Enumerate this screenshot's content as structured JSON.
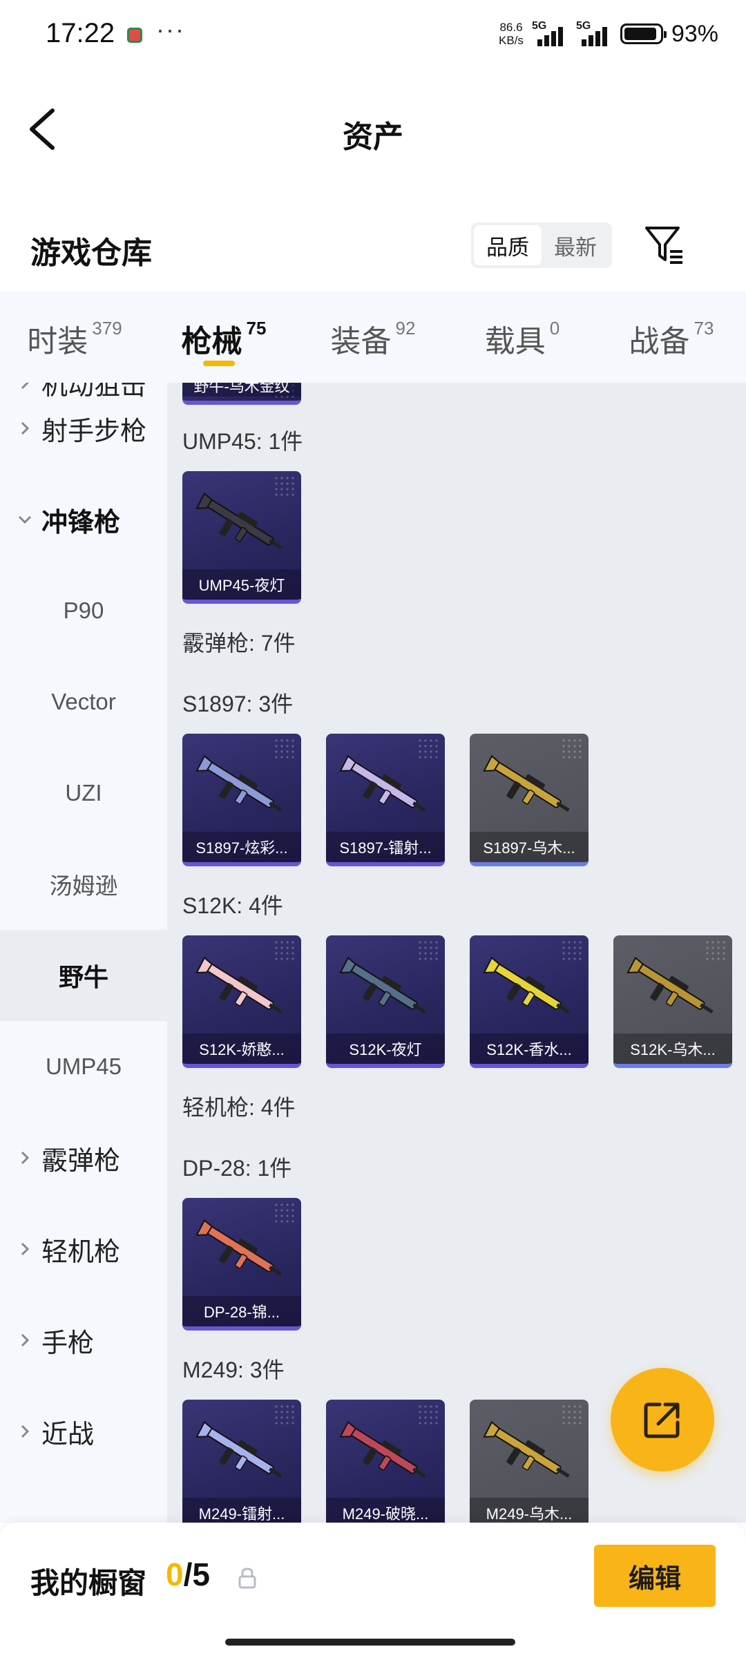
{
  "status_bar": {
    "time": "17:22",
    "more": "···",
    "net_speed_value": "86.6",
    "net_speed_unit": "KB/s",
    "signal1_label": "5G",
    "signal2_label": "5G",
    "battery_pct": "93%",
    "battery_level": 0.93
  },
  "header": {
    "title": "资产",
    "back_icon": "chevron-left-icon"
  },
  "warehouse": {
    "title": "游戏仓库",
    "sort_options": [
      "品质",
      "最新"
    ],
    "sort_selected": "品质",
    "filter_icon": "filter-icon"
  },
  "tabs": [
    {
      "label": "时装",
      "count": "379",
      "active": false
    },
    {
      "label": "枪械",
      "count": "75",
      "active": true
    },
    {
      "label": "装备",
      "count": "92",
      "active": false
    },
    {
      "label": "载具",
      "count": "0",
      "active": false
    },
    {
      "label": "战备",
      "count": "73",
      "active": false
    }
  ],
  "sidebar": {
    "items": [
      {
        "label": "射手步枪",
        "type": "group"
      },
      {
        "label": "冲锋枪",
        "type": "group",
        "open": true
      },
      {
        "label": "P90",
        "type": "sub"
      },
      {
        "label": "Vector",
        "type": "sub"
      },
      {
        "label": "UZI",
        "type": "sub"
      },
      {
        "label": "汤姆逊",
        "type": "sub"
      },
      {
        "label": "野牛",
        "type": "sub",
        "selected": true
      },
      {
        "label": "UMP45",
        "type": "sub"
      },
      {
        "label": "霰弹枪",
        "type": "group"
      },
      {
        "label": "轻机枪",
        "type": "group"
      },
      {
        "label": "手枪",
        "type": "group"
      },
      {
        "label": "近战",
        "type": "group"
      }
    ]
  },
  "content": {
    "partial_card_label": "野牛-乌木金纹",
    "sections": [
      {
        "label": "UMP45: 1件",
        "cards": [
          {
            "name": "UMP45-夜灯",
            "style": "purple",
            "gun_color": "#3c3b44"
          }
        ]
      },
      {
        "label": "霰弹枪: 7件",
        "cards": []
      },
      {
        "label": "S1897: 3件",
        "cards": [
          {
            "name": "S1897-炫彩...",
            "style": "purple",
            "gun_color": "#8c9ad8"
          },
          {
            "name": "S1897-镭射...",
            "style": "purple",
            "gun_color": "#c6b6ea"
          },
          {
            "name": "S1897-乌木...",
            "style": "grey",
            "gun_color": "#c9a43a"
          }
        ]
      },
      {
        "label": "S12K: 4件",
        "cards": [
          {
            "name": "S12K-娇憨...",
            "style": "purple",
            "gun_color": "#f2c6cc"
          },
          {
            "name": "S12K-夜灯",
            "style": "purple",
            "gun_color": "#56708a"
          },
          {
            "name": "S12K-香水...",
            "style": "purple",
            "gun_color": "#e6d43a"
          },
          {
            "name": "S12K-乌木...",
            "style": "grey",
            "gun_color": "#b99536"
          }
        ]
      },
      {
        "label": "轻机枪: 4件",
        "cards": []
      },
      {
        "label": "DP-28: 1件",
        "cards": [
          {
            "name": "DP-28-锦...",
            "style": "purple",
            "gun_color": "#e07258"
          }
        ]
      },
      {
        "label": "M249: 3件",
        "cards": [
          {
            "name": "M249-镭射...",
            "style": "purple",
            "gun_color": "#a6b2ee"
          },
          {
            "name": "M249-破晓...",
            "style": "purple",
            "gun_color": "#c0475a"
          },
          {
            "name": "M249-乌木...",
            "style": "grey",
            "gun_color": "#caa43a"
          }
        ]
      }
    ]
  },
  "fab": {
    "icon": "share-external-icon",
    "color": "#f9b517"
  },
  "bottom_bar": {
    "title": "我的橱窗",
    "current": "0",
    "separator": "/",
    "max": "5",
    "lock_icon": "lock-icon",
    "edit_label": "编辑"
  },
  "colors": {
    "accent": "#f5b800",
    "button": "#f9b517",
    "card_purple": "#2a2760",
    "card_grey": "#55565e"
  }
}
